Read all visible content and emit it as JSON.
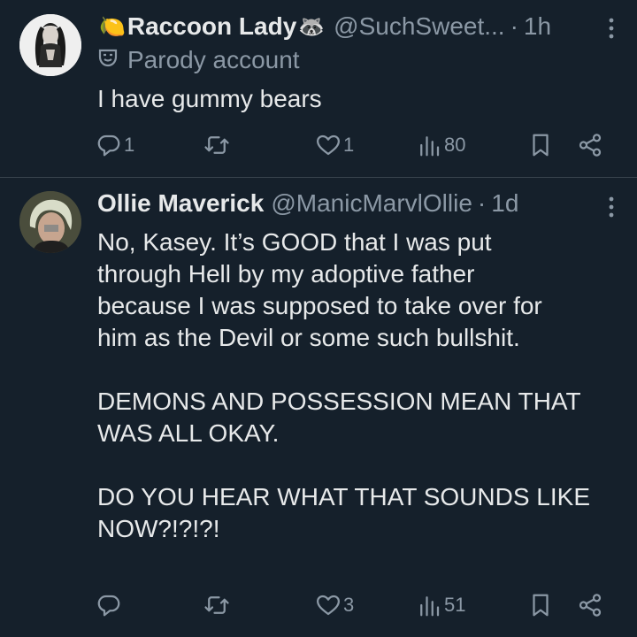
{
  "tweets": [
    {
      "name": "Raccoon Lady",
      "name_prefix_emoji": "🍋",
      "name_suffix_emoji": "🦝",
      "handle": "@SuchSweet...",
      "separator": "·",
      "time": "1h",
      "label": "Parody account",
      "text": "I have gummy bears",
      "replies": "1",
      "retweets": "",
      "likes": "1",
      "views": "80"
    },
    {
      "name": "Ollie Maverick",
      "handle": "@ManicMarvlOllie",
      "separator": "·",
      "time": "1d",
      "text": "No, Kasey. It’s GOOD that I was put\nthrough Hell by my adoptive father\nbecause I was supposed to take over for\nhim as the Devil or some such bullshit.\n\nDEMONS AND POSSESSION MEAN THAT\nWAS ALL OKAY.\n\nDO YOU HEAR WHAT THAT SOUNDS LIKE\nNOW?!?!?!",
      "replies": "",
      "retweets": "",
      "likes": "3",
      "views": "51"
    }
  ],
  "icons": {
    "reply": "reply-icon",
    "retweet": "retweet-icon",
    "like": "heart-icon",
    "views": "views-icon",
    "bookmark": "bookmark-icon",
    "share": "share-icon",
    "more": "more-icon",
    "parody": "parody-mask-icon"
  },
  "colors": {
    "background": "#15202b",
    "text": "#e7e9ea",
    "muted": "#8b98a5",
    "divider": "#38444d"
  }
}
